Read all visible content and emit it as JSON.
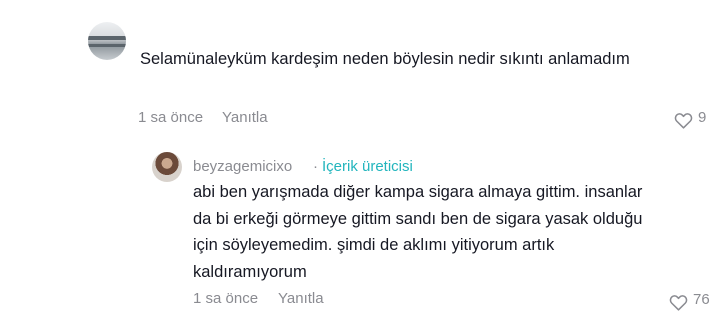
{
  "comment": {
    "username": "",
    "text": "Selamünaleyküm kardeşim neden böylesin nedir sıkıntı anlamadım",
    "time": "1 sa önce",
    "reply_label": "Yanıtla",
    "likes": "9",
    "avatar_icon": "user-avatar-icon",
    "like_icon": "heart-outline-icon"
  },
  "reply": {
    "username": "beyzagemicixo",
    "separator": "·",
    "creator_badge": "İçerik üreticisi",
    "text": "abi ben yarışmada diğer kampa sigara almaya gittim. insanlar da bi erkeği görmeye gittim sandı ben de sigara yasak olduğu için söyleyemedim. şimdi de aklımı yitiyorum artık kaldıramıyorum",
    "time": "1 sa önce",
    "reply_label": "Yanıtla",
    "likes": "76",
    "avatar_icon": "user-avatar-icon",
    "like_icon": "heart-outline-icon"
  },
  "colors": {
    "text": "#161823",
    "muted": "#8a8b91",
    "creator_badge": "#22b5bd"
  }
}
